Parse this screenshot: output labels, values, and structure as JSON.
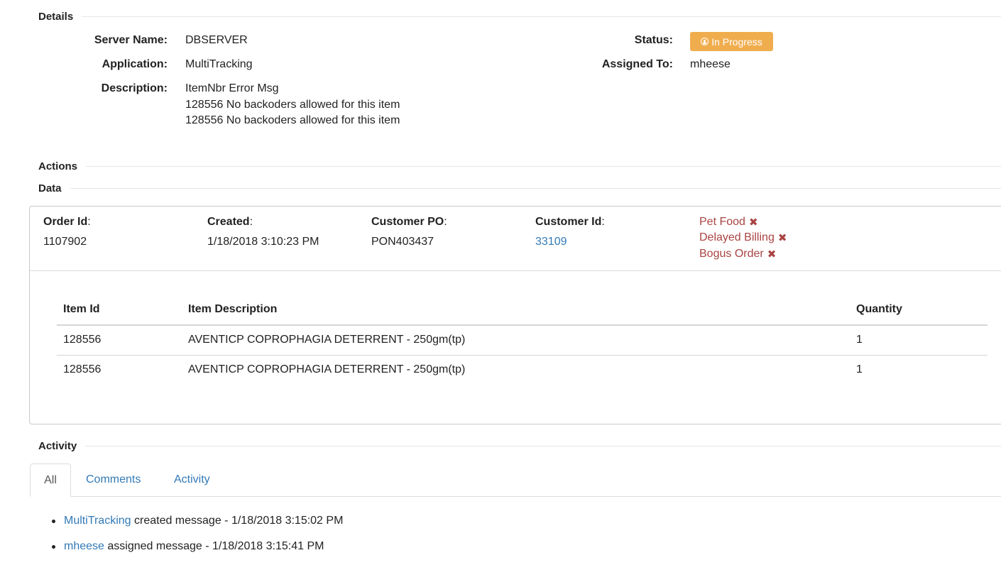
{
  "details": {
    "heading": "Details",
    "server_name_label": "Server Name:",
    "server_name": "DBSERVER",
    "application_label": "Application:",
    "application": "MultiTracking",
    "description_label": "Description:",
    "description_lines": [
      "ItemNbr Error Msg",
      "128556 No backoders allowed for this item",
      "128556 No backoders allowed for this item"
    ],
    "status_label": "Status:",
    "status": "In Progress",
    "status_icon": "user-circle-icon",
    "status_color": "#f0ad4e",
    "assigned_to_label": "Assigned To:",
    "assigned_to": "mheese"
  },
  "actions": {
    "heading": "Actions"
  },
  "data": {
    "heading": "Data",
    "order_id_label": "Order Id",
    "order_id": "1107902",
    "created_label": "Created",
    "created": "1/18/2018 3:10:23 PM",
    "customer_po_label": "Customer PO",
    "customer_po": "PON403437",
    "customer_id_label": "Customer Id",
    "customer_id": "33109",
    "tags": [
      "Pet Food",
      "Delayed Billing",
      "Bogus Order"
    ],
    "tag_remove_icon": "close-icon",
    "tag_color": "#a94442",
    "link_color": "#337ab7",
    "table": {
      "columns": [
        "Item Id",
        "Item Description",
        "Quantity"
      ],
      "rows": [
        [
          "128556",
          "AVENTICP COPROPHAGIA DETERRENT - 250gm(tp)",
          "1"
        ],
        [
          "128556",
          "AVENTICP COPROPHAGIA DETERRENT - 250gm(tp)",
          "1"
        ]
      ]
    }
  },
  "activity": {
    "heading": "Activity",
    "tabs": [
      "All",
      "Comments",
      "Activity"
    ],
    "active_tab": "All",
    "items": [
      {
        "actor": "MultiTracking",
        "text": " created message - 1/18/2018 3:15:02 PM"
      },
      {
        "actor": "mheese",
        "text": " assigned message - 1/18/2018 3:15:41 PM"
      }
    ]
  }
}
